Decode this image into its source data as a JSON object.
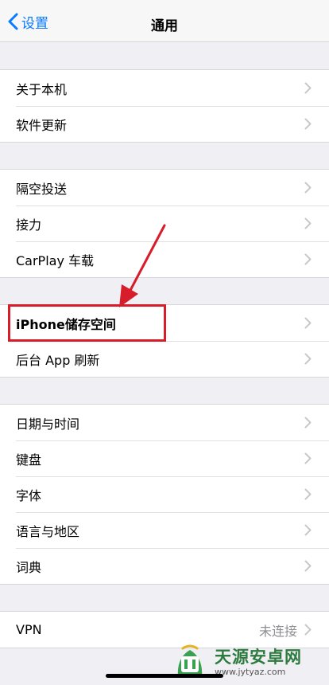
{
  "nav": {
    "back_label": "设置",
    "title": "通用"
  },
  "groups": [
    {
      "rows": [
        {
          "label": "关于本机"
        },
        {
          "label": "软件更新"
        }
      ]
    },
    {
      "rows": [
        {
          "label": "隔空投送"
        },
        {
          "label": "接力"
        },
        {
          "label": "CarPlay 车载"
        }
      ]
    },
    {
      "rows": [
        {
          "label": "iPhone储存空间"
        },
        {
          "label": "后台 App 刷新"
        }
      ]
    },
    {
      "rows": [
        {
          "label": "日期与时间"
        },
        {
          "label": "键盘"
        },
        {
          "label": "字体"
        },
        {
          "label": "语言与地区"
        },
        {
          "label": "词典"
        }
      ]
    },
    {
      "rows": [
        {
          "label": "VPN",
          "detail": "未连接"
        }
      ]
    }
  ],
  "annotation": {
    "color": "#d71c2a",
    "target": "iPhone储存空间"
  },
  "watermark": {
    "name": "天源安卓网",
    "url": "www.jytyaz.com"
  },
  "colors": {
    "accent": "#0a7aff",
    "background": "#efeff4",
    "chevron": "#c7c7cc"
  }
}
